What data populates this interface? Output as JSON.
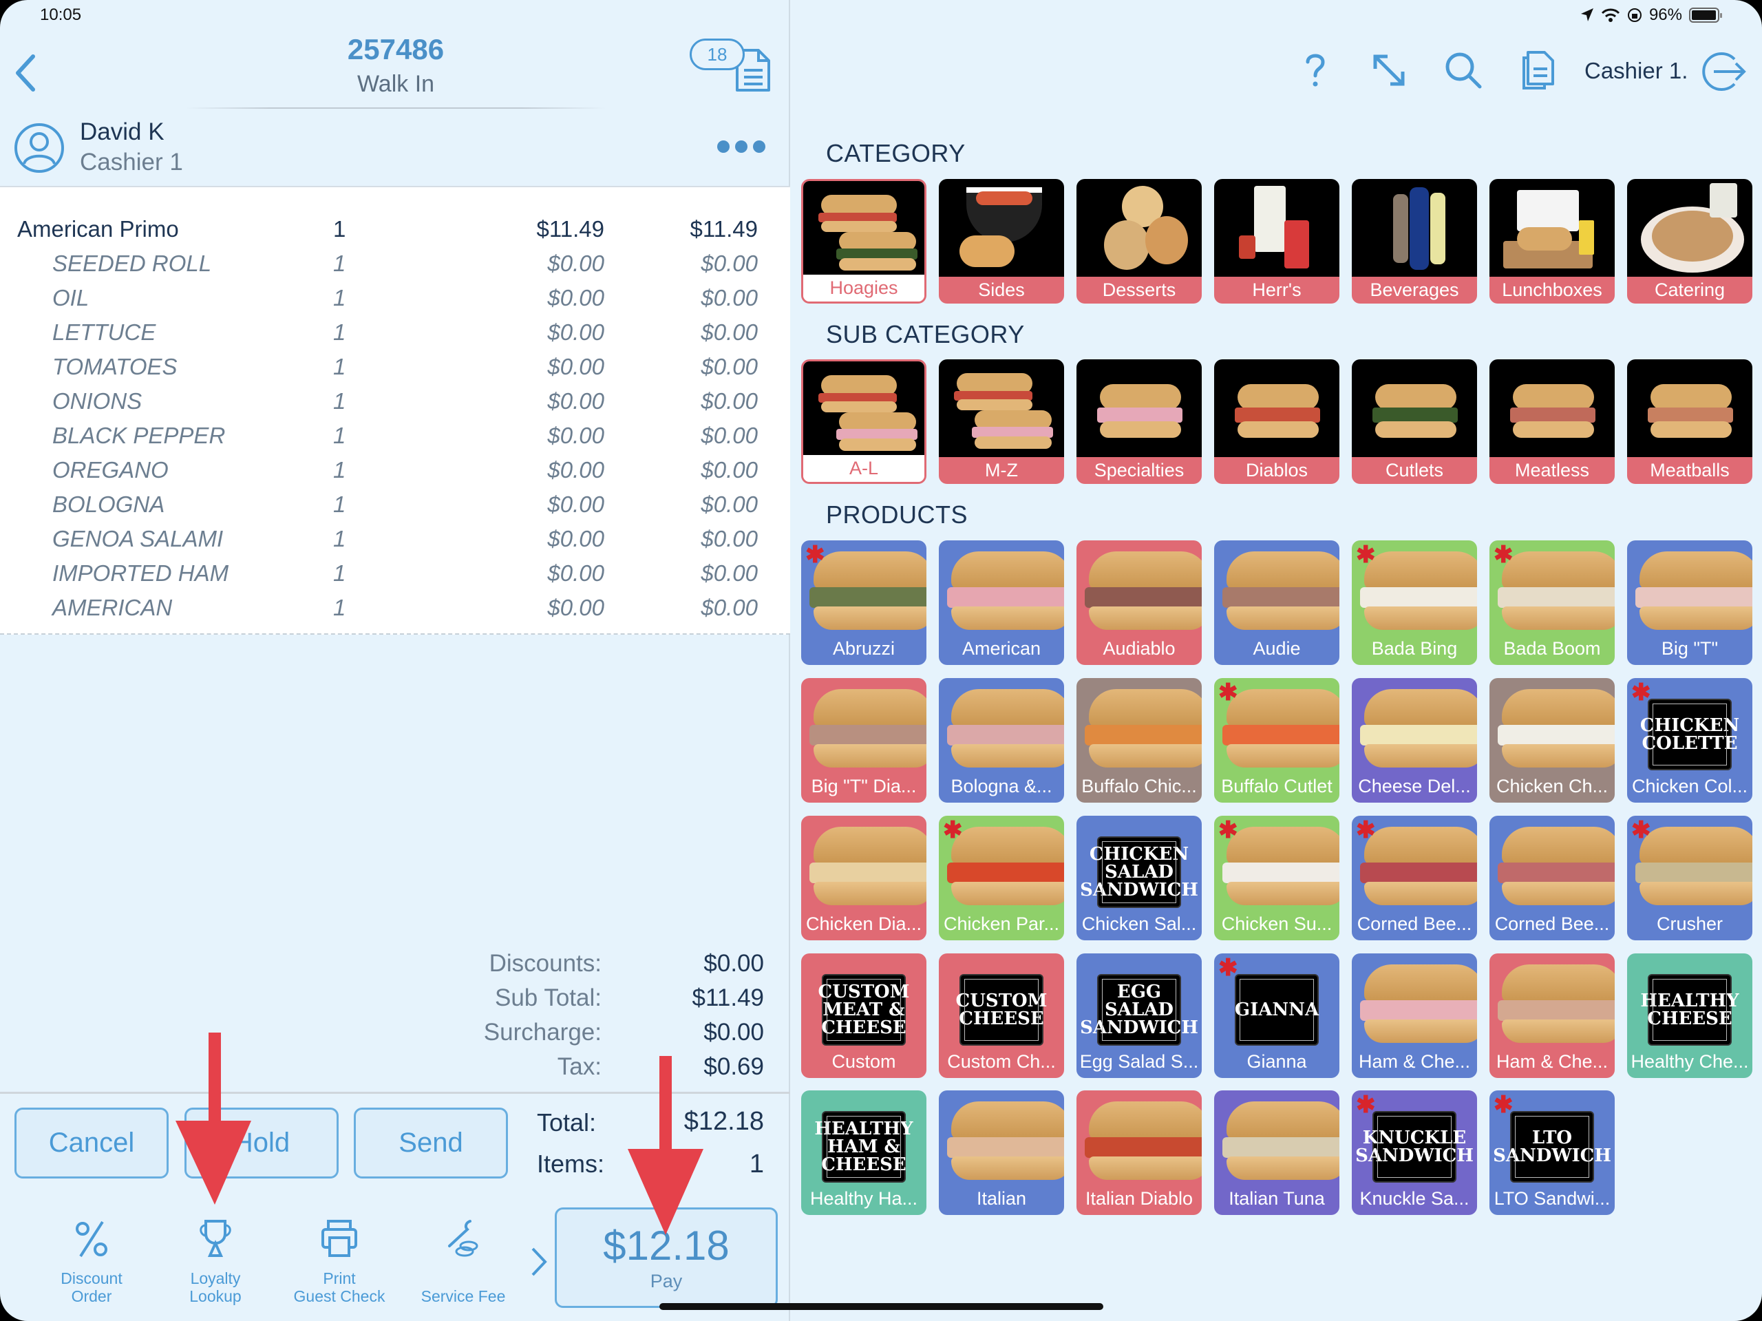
{
  "status_bar": {
    "time": "10:05",
    "battery": "96%",
    "battery_level": 0.96
  },
  "order": {
    "number": "257486",
    "type": "Walk In",
    "open_tickets": "18",
    "customer_name": "David K",
    "customer_role": "Cashier 1"
  },
  "items": [
    {
      "name": "American Primo",
      "qty": "1",
      "price": "$11.49",
      "total": "$11.49",
      "kind": "main"
    },
    {
      "name": "SEEDED ROLL",
      "qty": "1",
      "price": "$0.00",
      "total": "$0.00",
      "kind": "mod"
    },
    {
      "name": "OIL",
      "qty": "1",
      "price": "$0.00",
      "total": "$0.00",
      "kind": "mod"
    },
    {
      "name": "LETTUCE",
      "qty": "1",
      "price": "$0.00",
      "total": "$0.00",
      "kind": "mod"
    },
    {
      "name": "TOMATOES",
      "qty": "1",
      "price": "$0.00",
      "total": "$0.00",
      "kind": "mod"
    },
    {
      "name": "ONIONS",
      "qty": "1",
      "price": "$0.00",
      "total": "$0.00",
      "kind": "mod"
    },
    {
      "name": "BLACK PEPPER",
      "qty": "1",
      "price": "$0.00",
      "total": "$0.00",
      "kind": "mod"
    },
    {
      "name": "OREGANO",
      "qty": "1",
      "price": "$0.00",
      "total": "$0.00",
      "kind": "mod"
    },
    {
      "name": "BOLOGNA",
      "qty": "1",
      "price": "$0.00",
      "total": "$0.00",
      "kind": "mod"
    },
    {
      "name": "GENOA SALAMI",
      "qty": "1",
      "price": "$0.00",
      "total": "$0.00",
      "kind": "mod"
    },
    {
      "name": "IMPORTED HAM",
      "qty": "1",
      "price": "$0.00",
      "total": "$0.00",
      "kind": "mod"
    },
    {
      "name": "AMERICAN",
      "qty": "1",
      "price": "$0.00",
      "total": "$0.00",
      "kind": "mod"
    }
  ],
  "summary": {
    "discounts_label": "Discounts:",
    "discounts": "$0.00",
    "subtotal_label": "Sub Total:",
    "subtotal": "$11.49",
    "surcharge_label": "Surcharge:",
    "surcharge": "$0.00",
    "tax_label": "Tax:",
    "tax": "$0.69",
    "total_label": "Total:",
    "total": "$12.18",
    "items_label": "Items:",
    "items_count": "1"
  },
  "actions": {
    "cancel": "Cancel",
    "hold": "Hold",
    "send": "Send"
  },
  "tools": [
    {
      "icon": "percent-icon",
      "label1": "Discount",
      "label2": "Order"
    },
    {
      "icon": "trophy-icon",
      "label1": "Loyalty",
      "label2": "Lookup"
    },
    {
      "icon": "printer-icon",
      "label1": "Print",
      "label2": "Guest Check"
    },
    {
      "icon": "wrench-coins-icon",
      "label1": "",
      "label2": "Service Fee"
    }
  ],
  "pay": {
    "amount": "$12.18",
    "label": "Pay"
  },
  "toolbar": {
    "cashier": "Cashier 1."
  },
  "sections": {
    "category": "CATEGORY",
    "sub_category": "SUB CATEGORY",
    "products": "PRODUCTS"
  },
  "categories": [
    {
      "label": "Hoagies",
      "selected": true
    },
    {
      "label": "Sides"
    },
    {
      "label": "Desserts"
    },
    {
      "label": "Herr's"
    },
    {
      "label": "Beverages"
    },
    {
      "label": "Lunchboxes"
    },
    {
      "label": "Catering"
    }
  ],
  "sub_categories": [
    {
      "label": "A-L",
      "selected": true
    },
    {
      "label": "M-Z"
    },
    {
      "label": "Specialties"
    },
    {
      "label": "Diablos"
    },
    {
      "label": "Cutlets"
    },
    {
      "label": "Meatless"
    },
    {
      "label": "Meatballs"
    }
  ],
  "colors": {
    "blue": "#5f7fcf",
    "red": "#e06a74",
    "green": "#8fd06a",
    "brown": "#9a8680",
    "purple": "#7267c9",
    "teal": "#66c2a7",
    "accent": "#4a9ad6",
    "annotation_arrow": "#e5414a"
  },
  "products": [
    {
      "label": "Abruzzi",
      "color": "blue",
      "star": true,
      "filling": "#6a7a4a"
    },
    {
      "label": "American",
      "color": "blue",
      "filling": "#e6a6b0"
    },
    {
      "label": "Audiablo",
      "color": "red",
      "filling": "#8f5a50"
    },
    {
      "label": "Audie",
      "color": "blue",
      "filling": "#a87a6a"
    },
    {
      "label": "Bada Bing",
      "color": "green",
      "star": true,
      "filling": "#f0ece2"
    },
    {
      "label": "Bada Boom",
      "color": "green",
      "star": true,
      "filling": "#e6dcc8"
    },
    {
      "label": "Big \"T\"",
      "color": "blue",
      "filling": "#e8c6c0"
    },
    {
      "label": "Big \"T\" Dia...",
      "color": "red",
      "filling": "#b89080"
    },
    {
      "label": "Bologna &...",
      "color": "blue",
      "filling": "#dba8a8"
    },
    {
      "label": "Buffalo Chic...",
      "color": "brown",
      "filling": "#e08a40"
    },
    {
      "label": "Buffalo Cutlet",
      "color": "green",
      "star": true,
      "filling": "#e86a3a"
    },
    {
      "label": "Cheese Del...",
      "color": "purple",
      "filling": "#f0e6b8"
    },
    {
      "label": "Chicken Ch...",
      "color": "brown",
      "filling": "#f0eee6"
    },
    {
      "label": "Chicken Col...",
      "color": "blue",
      "star": true,
      "sign": "CHICKEN COLETTE"
    },
    {
      "label": "Chicken Dia...",
      "color": "red",
      "filling": "#e8d0a0"
    },
    {
      "label": "Chicken Par...",
      "color": "green",
      "star": true,
      "filling": "#d8482a"
    },
    {
      "label": "Chicken Sal...",
      "color": "blue",
      "sign": "CHICKEN SALAD SANDWICH"
    },
    {
      "label": "Chicken Su...",
      "color": "green",
      "star": true,
      "filling": "#f0ece6"
    },
    {
      "label": "Corned Bee...",
      "color": "blue",
      "star": true,
      "filling": "#b84a50"
    },
    {
      "label": "Corned Bee...",
      "color": "blue",
      "filling": "#c06a6a"
    },
    {
      "label": "Crusher",
      "color": "blue",
      "star": true,
      "filling": "#c8b890"
    },
    {
      "label": "Custom",
      "color": "red",
      "sign": "CUSTOM MEAT & CHEESE"
    },
    {
      "label": "Custom Ch...",
      "color": "red",
      "sign": "CUSTOM CHEESE"
    },
    {
      "label": "Egg Salad S...",
      "color": "blue",
      "sign": "EGG SALAD SANDWICH"
    },
    {
      "label": "Gianna",
      "color": "blue",
      "star": true,
      "sign": "GIANNA"
    },
    {
      "label": "Ham & Che...",
      "color": "blue",
      "filling": "#e8b0b8"
    },
    {
      "label": "Ham & Che...",
      "color": "red",
      "filling": "#d4a890"
    },
    {
      "label": "Healthy Che...",
      "color": "teal",
      "sign": "HEALTHY CHEESE"
    },
    {
      "label": "Healthy Ha...",
      "color": "teal",
      "sign": "HEALTHY HAM & CHEESE"
    },
    {
      "label": "Italian",
      "color": "blue",
      "filling": "#e0b898"
    },
    {
      "label": "Italian Diablo",
      "color": "red",
      "filling": "#c84a30"
    },
    {
      "label": "Italian Tuna",
      "color": "purple",
      "filling": "#d8ccb0"
    },
    {
      "label": "Knuckle Sa...",
      "color": "purple",
      "star": true,
      "sign": "KNUCKLE SANDWICH"
    },
    {
      "label": "LTO Sandwi...",
      "color": "blue",
      "star": true,
      "sign": "LTO SANDWICH"
    }
  ]
}
